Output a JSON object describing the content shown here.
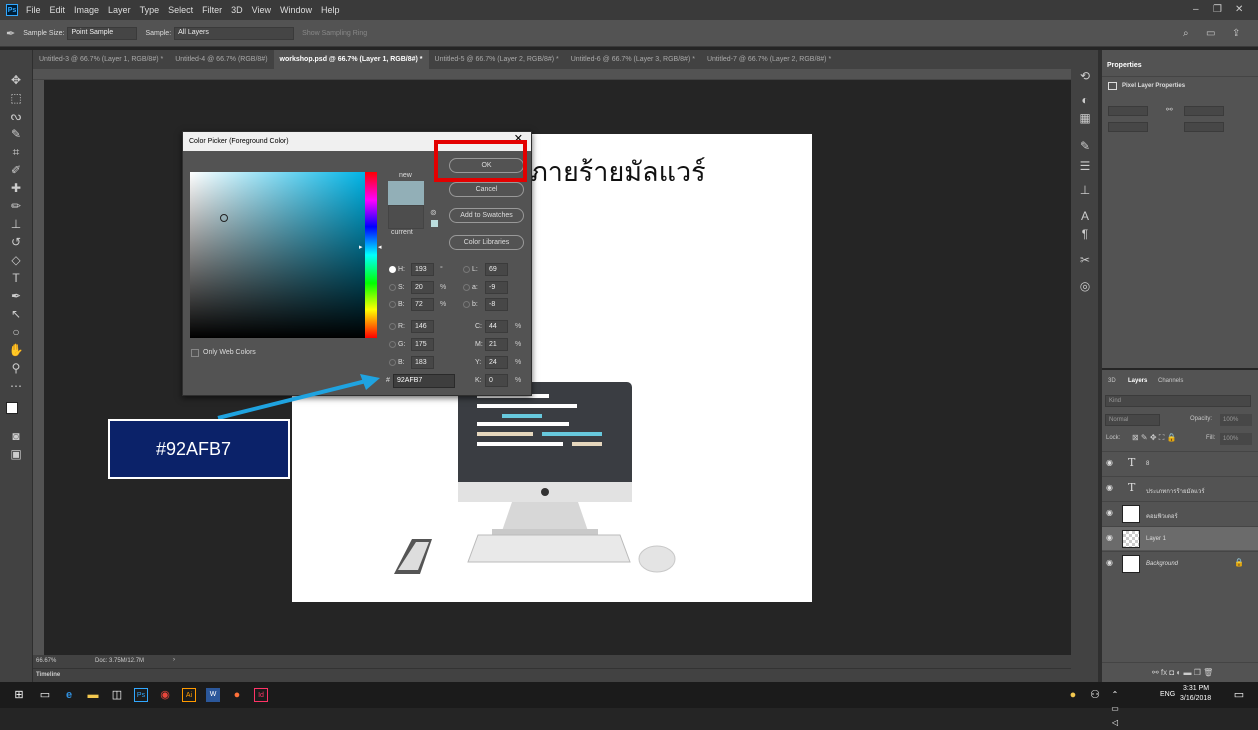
{
  "menubar": {
    "logo": "Ps",
    "items": [
      "File",
      "Edit",
      "Image",
      "Layer",
      "Type",
      "Select",
      "Filter",
      "3D",
      "View",
      "Window",
      "Help"
    ]
  },
  "options": {
    "sample_size_label": "Sample Size:",
    "sample_size_value": "Point Sample",
    "sample_label": "Sample:",
    "sample_value": "All Layers",
    "show_ring": "Show Sampling Ring"
  },
  "tabs": [
    {
      "label": "Untitled-3 @ 66.7% (Layer 1, RGB/8#) *",
      "active": false
    },
    {
      "label": "Untitled-4 @ 66.7% (RGB/8#)",
      "active": false
    },
    {
      "label": "workshop.psd @ 66.7% (Layer 1, RGB/8#) *",
      "active": true
    },
    {
      "label": "Untitled-5 @ 66.7% (Layer 2, RGB/8#) *",
      "active": false
    },
    {
      "label": "Untitled-6 @ 66.7% (Layer 3, RGB/8#) *",
      "active": false
    },
    {
      "label": "Untitled-7 @ 66.7% (Layer 2, RGB/8#) *",
      "active": false
    }
  ],
  "canvas": {
    "thai_text": "ภายร้ายมัลแวร์"
  },
  "dialog": {
    "title": "Color Picker (Foreground Color)",
    "ok": "OK",
    "cancel": "Cancel",
    "add_swatches": "Add to Swatches",
    "color_libraries": "Color Libraries",
    "new_label": "new",
    "current_label": "current",
    "only_web": "Only Web Colors",
    "H": "193",
    "S": "20",
    "B": "72",
    "R": "146",
    "G": "175",
    "Bb": "183",
    "L": "69",
    "a": "-9",
    "b": "-8",
    "C": "44",
    "M": "21",
    "Y": "24",
    "K": "0",
    "hex": "92AFB7",
    "new_color": "#92afb7"
  },
  "annotation": {
    "hex_label": "#92AFB7"
  },
  "status": {
    "zoom": "66.67%",
    "doc": "Doc: 3.75M/12.7M",
    "timeline": "Timeline"
  },
  "properties": {
    "title": "Properties",
    "subtitle": "Pixel Layer Properties"
  },
  "layers_panel": {
    "tabs": [
      "3D",
      "Layers",
      "Channels"
    ],
    "kind": "Kind",
    "blend": "Normal",
    "opacity_label": "Opacity:",
    "opacity": "100%",
    "lock_label": "Lock:",
    "fill_label": "Fill:",
    "fill": "100%",
    "layers": [
      {
        "name": "8",
        "type": "text"
      },
      {
        "name": "ประเภทการร้ายมัลแวร์",
        "type": "text"
      },
      {
        "name": "คอมพิวเตอร์",
        "type": "image"
      },
      {
        "name": "Layer 1",
        "type": "image",
        "selected": true
      },
      {
        "name": "Background",
        "type": "bg"
      }
    ]
  },
  "taskbar": {
    "time": "3:31 PM",
    "date": "3/16/2018",
    "lang": "ENG"
  }
}
